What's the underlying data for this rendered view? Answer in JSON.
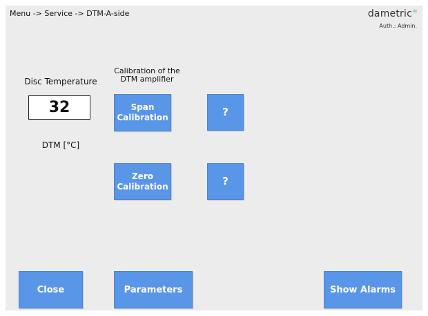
{
  "header": {
    "breadcrumb": "Menu -> Service -> DTM-A-side",
    "brand": "dametric",
    "auth": "Auth.: Admin."
  },
  "temperature": {
    "title": "Disc Temperature",
    "value": "32",
    "unit_label": "DTM [°C]"
  },
  "calibration": {
    "title_line1": "Calibration of the",
    "title_line2": "DTM amplifier",
    "span_line1": "Span",
    "span_line2": "Calibration",
    "zero_line1": "Zero",
    "zero_line2": "Calibration",
    "help_label": "?"
  },
  "footer": {
    "close_label": "Close",
    "parameters_label": "Parameters",
    "alarms_label": "Show Alarms"
  },
  "colors": {
    "button": "#5a96e8",
    "background": "#ececec",
    "brand_accent": "#8fe0c0"
  }
}
